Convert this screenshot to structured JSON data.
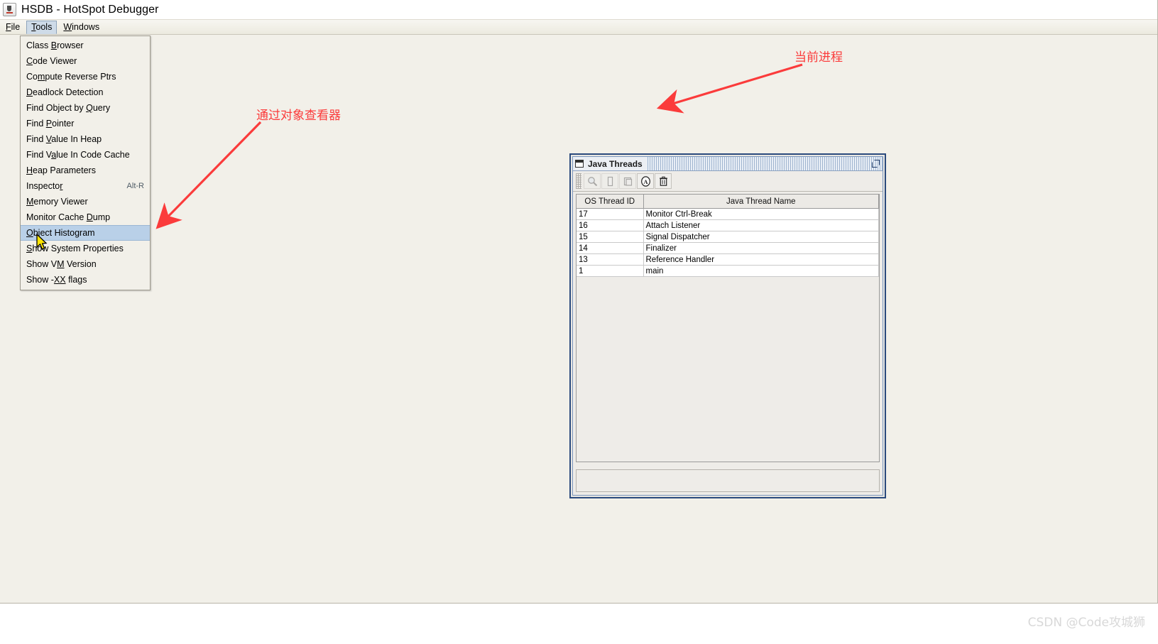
{
  "window": {
    "title": "HSDB - HotSpot Debugger",
    "app_icon": "java-coffee-cup-icon"
  },
  "menubar": {
    "items": [
      {
        "label": "File",
        "mnemonic": "F",
        "open": false
      },
      {
        "label": "Tools",
        "mnemonic": "T",
        "open": true
      },
      {
        "label": "Windows",
        "mnemonic": "W",
        "open": false
      }
    ]
  },
  "tools_menu": {
    "items": [
      {
        "label": "Class Browser",
        "mnemonic": "B",
        "accel": "",
        "selected": false
      },
      {
        "label": "Code Viewer",
        "mnemonic": "C",
        "accel": "",
        "selected": false
      },
      {
        "label": "Compute Reverse Ptrs",
        "mnemonic": "m",
        "accel": "",
        "selected": false
      },
      {
        "label": "Deadlock Detection",
        "mnemonic": "D",
        "accel": "",
        "selected": false
      },
      {
        "label": "Find Object by Query",
        "mnemonic": "Q",
        "accel": "",
        "selected": false
      },
      {
        "label": "Find Pointer",
        "mnemonic": "P",
        "accel": "",
        "selected": false
      },
      {
        "label": "Find Value In Heap",
        "mnemonic": "V",
        "accel": "",
        "selected": false
      },
      {
        "label": "Find Value In Code Cache",
        "mnemonic": "a",
        "accel": "",
        "selected": false
      },
      {
        "label": "Heap Parameters",
        "mnemonic": "H",
        "accel": "",
        "selected": false
      },
      {
        "label": "Inspector",
        "mnemonic": "r",
        "accel": "Alt-R",
        "selected": false
      },
      {
        "label": "Memory Viewer",
        "mnemonic": "M",
        "accel": "",
        "selected": false
      },
      {
        "label": "Monitor Cache Dump",
        "mnemonic": "D",
        "accel": "",
        "selected": false
      },
      {
        "label": "Object Histogram",
        "mnemonic": "O",
        "accel": "",
        "selected": true
      },
      {
        "label": "Show System Properties",
        "mnemonic": "S",
        "accel": "",
        "selected": false
      },
      {
        "label": "Show VM Version",
        "mnemonic": "M",
        "accel": "",
        "selected": false
      },
      {
        "label": "Show -XX flags",
        "mnemonic": "XX",
        "accel": "",
        "selected": false
      }
    ]
  },
  "java_threads_window": {
    "title": "Java Threads",
    "frame_icon": "window-frame-icon",
    "maximize_label": "Maximize",
    "toolbar": {
      "buttons": [
        {
          "name": "inspect-button",
          "icon": "magnifier-icon",
          "enabled": false
        },
        {
          "name": "stack-memory-button",
          "icon": "document-icon",
          "enabled": false
        },
        {
          "name": "monitor-cache-button",
          "icon": "stacked-pages-icon",
          "enabled": false
        },
        {
          "name": "oop-inspector-button",
          "icon": "circled-a-icon",
          "enabled": true
        },
        {
          "name": "delete-button",
          "icon": "trash-icon",
          "enabled": true
        }
      ]
    },
    "table": {
      "columns": [
        "OS Thread ID",
        "Java Thread Name"
      ],
      "rows": [
        {
          "os_thread_id": "17",
          "java_thread_name": "Monitor Ctrl-Break"
        },
        {
          "os_thread_id": "16",
          "java_thread_name": "Attach Listener"
        },
        {
          "os_thread_id": "15",
          "java_thread_name": "Signal Dispatcher"
        },
        {
          "os_thread_id": "14",
          "java_thread_name": "Finalizer"
        },
        {
          "os_thread_id": "13",
          "java_thread_name": "Reference Handler"
        },
        {
          "os_thread_id": "1",
          "java_thread_name": "main"
        }
      ]
    },
    "statusbar_text": ""
  },
  "annotations": {
    "color": "#fb3b3b",
    "items": [
      {
        "text": "当前进程",
        "name": "annotation-current-process"
      },
      {
        "text": "通过对象查看器",
        "name": "annotation-object-viewer"
      }
    ]
  },
  "watermark": {
    "text": "CSDN @Code攻城狮"
  }
}
